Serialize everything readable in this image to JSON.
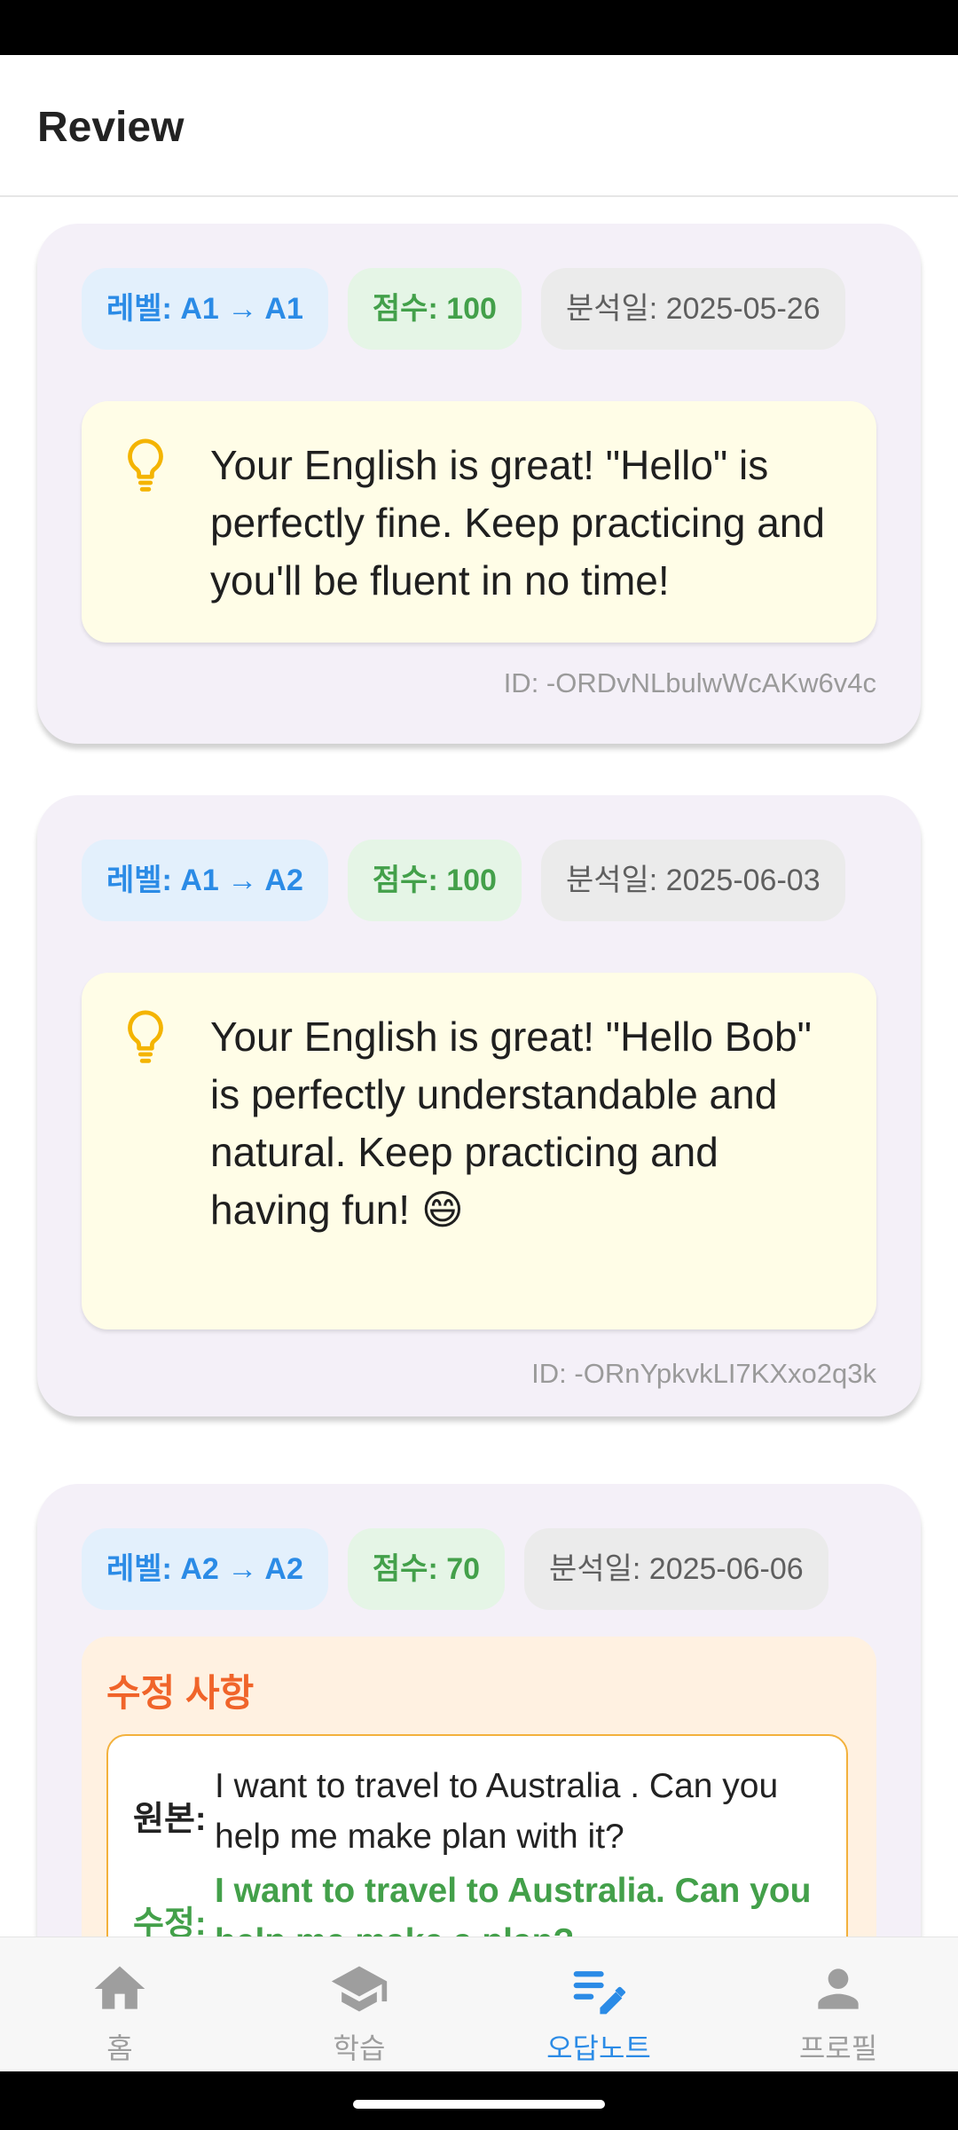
{
  "app_bar": {
    "title": "Review"
  },
  "reviews": [
    {
      "level": "레벨: A1 → A1",
      "score": "점수: 100",
      "date": "분석일: 2025-05-26",
      "feedback": "Your English is great!  \"Hello\" is perfectly fine.  Keep practicing and you'll be fluent in no time!",
      "id": "ID: -ORDvNLbulwWcAKw6v4c"
    },
    {
      "level": "레벨: A1 → A2",
      "score": "점수: 100",
      "date": "분석일: 2025-06-03",
      "feedback": "Your English is great!  \"Hello Bob\" is perfectly understandable and natural.  Keep practicing and having fun! 😄",
      "id": "ID: -ORnYpkvkLI7KXxo2q3k"
    },
    {
      "level": "레벨: A2 → A2",
      "score": "점수: 70",
      "date": "분석일: 2025-06-06",
      "corrections_title": "수정 사항",
      "original_label": "원본:",
      "original_text": "I want to travel to Australia . Can you help me make plan with it?",
      "fixed_label": "수정:",
      "fixed_text": "I want to travel to Australia. Can you help me make a plan?"
    }
  ],
  "bottom_nav": {
    "items": [
      {
        "label": "홈",
        "icon": "home-icon"
      },
      {
        "label": "학습",
        "icon": "school-icon"
      },
      {
        "label": "오답노트",
        "icon": "edit-note-icon",
        "active": true
      },
      {
        "label": "프로필",
        "icon": "person-icon"
      }
    ]
  },
  "colors": {
    "accent": "#2b8be6",
    "score_green": "#43a04a",
    "correction_orange": "#f0642a",
    "card_bg": "#f4f0f8",
    "feedback_bg": "#fffde7"
  }
}
